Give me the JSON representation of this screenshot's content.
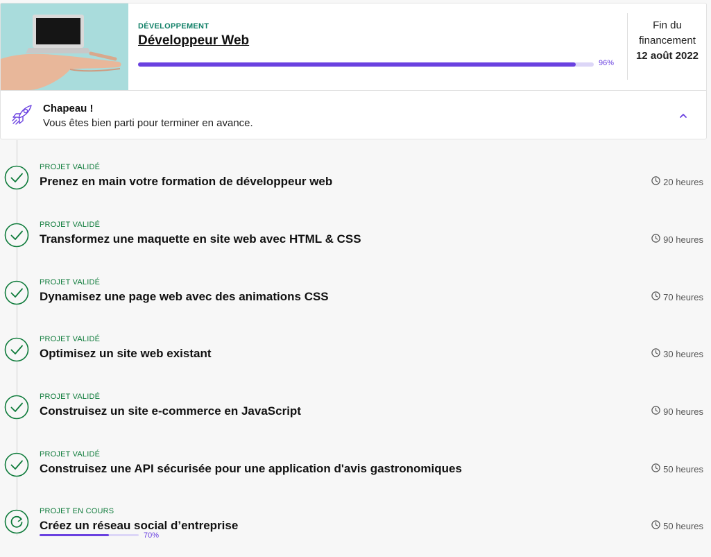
{
  "course": {
    "category": "Développement",
    "title": "Développeur Web",
    "progress": 0.96,
    "progress_label": "96%",
    "funding_label": "Fin du financement",
    "funding_date": "12 août 2022"
  },
  "congrats": {
    "title": "Chapeau !",
    "text": "Vous êtes bien parti pour terminer en avance."
  },
  "projects": [
    {
      "status": "Projet validé",
      "title": "Prenez en main votre formation de développeur web",
      "duration": "20 heures"
    },
    {
      "status": "Projet validé",
      "title": "Transformez une maquette en site web avec HTML & CSS",
      "duration": "90 heures"
    },
    {
      "status": "Projet validé",
      "title": "Dynamisez une page web avec des animations CSS",
      "duration": "70 heures"
    },
    {
      "status": "Projet validé",
      "title": "Optimisez un site web existant",
      "duration": "30 heures"
    },
    {
      "status": "Projet validé",
      "title": "Construisez un site e-commerce en JavaScript",
      "duration": "90 heures"
    },
    {
      "status": "Projet validé",
      "title": "Construisez une API sécurisée pour une application d'avis gastronomiques",
      "duration": "50 heures"
    },
    {
      "status": "Projet en cours",
      "title": "Créez un réseau social d’entreprise",
      "duration": "50 heures",
      "progress": 0.7,
      "progress_label": "70%"
    }
  ],
  "colors": {
    "accent": "#6a41e0",
    "validated": "#0c7a39",
    "category": "#0f7f66"
  },
  "icons": {
    "done": "check-circle-icon",
    "in_progress": "refresh-circle-icon",
    "duration": "clock-icon",
    "congrats": "rocket-icon",
    "collapse": "chevron-up-icon"
  }
}
